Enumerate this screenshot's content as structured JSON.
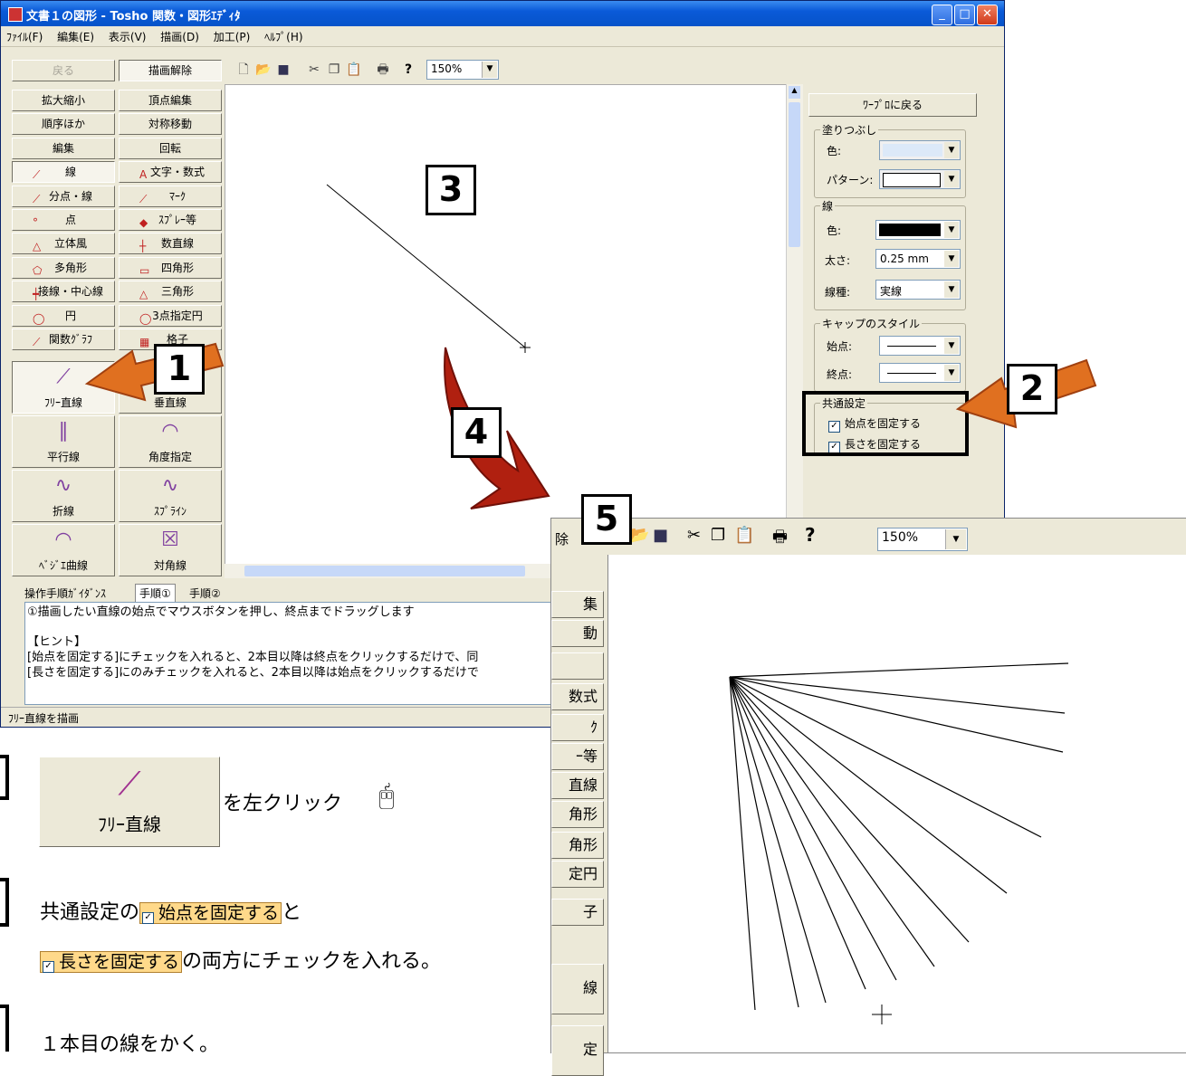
{
  "window": {
    "title": "文書１の図形 - Tosho 関数・図形ｴﾃﾞｨﾀ"
  },
  "menu": [
    "ﾌｧｲﾙ(F)",
    "編集(E)",
    "表示(V)",
    "描画(D)",
    "加工(P)",
    "ﾍﾙﾌﾟ(H)"
  ],
  "toolbar": {
    "back_label": "戻る",
    "cancel_label": "描画解除",
    "zoom": "150%"
  },
  "tools": [
    "拡大縮小",
    "頂点編集",
    "順序ほか",
    "対称移動",
    "編集",
    "回転",
    "線",
    "文字・数式",
    "分点・線",
    "ﾏｰｸ",
    "点",
    "ｽﾌﾟﾚｰ等",
    "立体風",
    "数直線",
    "多角形",
    "四角形",
    "接線・中心線",
    "三角形",
    "円",
    "3点指定円",
    "関数ｸﾞﾗﾌ",
    "格子"
  ],
  "shape_tools": [
    "ﾌﾘｰ直線",
    "垂直線",
    "平行線",
    "角度指定",
    "折線",
    "ｽﾌﾟﾗｲﾝ",
    "ﾍﾞｼﾞｴ曲線",
    "対角線"
  ],
  "guidance": {
    "tabs": [
      "操作手順ｶﾞｲﾀﾞﾝｽ",
      "手順①",
      "手順②"
    ],
    "line1": "①描画したい直線の始点でマウスボタンを押し、終点までドラッグします",
    "hint_title": "【ヒント】",
    "hint1": "[始点を固定する]にチェックを入れると、2本目以降は終点をクリックするだけで、同",
    "hint2": "[長さを固定する]にのみチェックを入れると、2本目以降は始点をクリックするだけで"
  },
  "status": "ﾌﾘｰ直線を描画",
  "props": {
    "back_button": "ﾜｰﾌﾟﾛに戻る",
    "fill_group": "塗りつぶし",
    "color_label": "色:",
    "pattern_label": "パターン:",
    "line_group": "線",
    "line_color_label": "色:",
    "width_label": "太さ:",
    "width_value": "0.25 mm",
    "type_label": "線種:",
    "type_value": "実線",
    "cap_group": "キャップのスタイル",
    "start_label": "始点:",
    "end_label": "終点:",
    "common_group": "共通設定",
    "fix_start": "始点を固定する",
    "fix_length": "長さを固定する",
    "check_mark": "✓",
    "colors": {
      "fill": "#dce9f8",
      "line": "#000000"
    }
  },
  "markers": [
    "1",
    "2",
    "3",
    "4",
    "5"
  ],
  "panel2": {
    "zoom": "150%",
    "side_labels": [
      "除",
      "集",
      "動",
      "",
      "数式",
      "ｸ",
      "ｰ等",
      "直線",
      "角形",
      "角形",
      "定円",
      "子",
      "線",
      "定"
    ]
  },
  "instructions": {
    "step1_button_label": "ﾌﾘｰ直線",
    "step1_text": "を左クリック",
    "step2_pre": "共通設定の",
    "step2_chk1": "始点を固定する",
    "step2_mid": "と",
    "step2_chk2": "長さを固定する",
    "step2_post": "の両方にチェックを入れる。",
    "step3_text": "１本目の線をかく。"
  }
}
